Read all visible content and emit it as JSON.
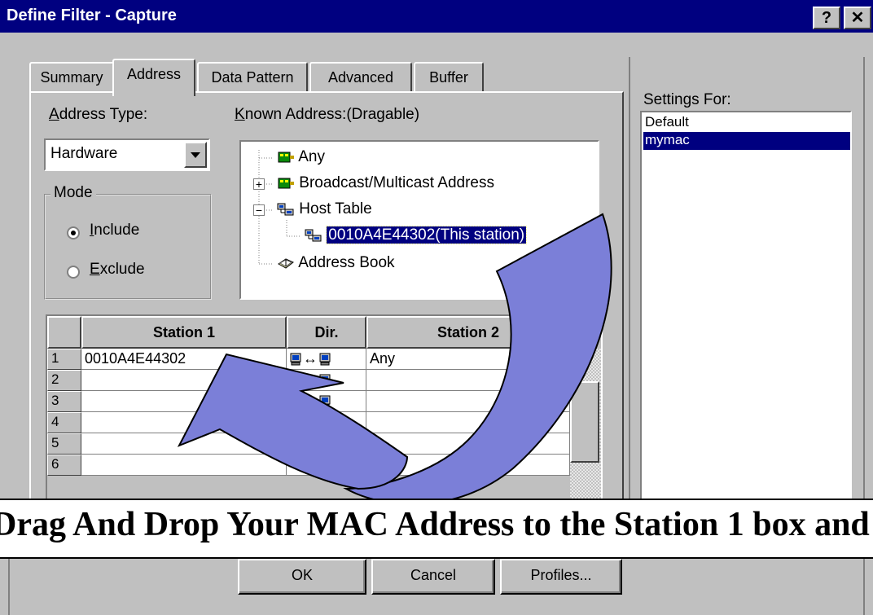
{
  "window": {
    "title": "Define Filter - Capture",
    "help_label": "?",
    "close_label": "✕"
  },
  "tabs": [
    {
      "label": "Summary"
    },
    {
      "label": "Address"
    },
    {
      "label": "Data Pattern"
    },
    {
      "label": "Advanced"
    },
    {
      "label": "Buffer"
    }
  ],
  "address_type": {
    "label_first": "A",
    "label_rest": "ddress Type:",
    "value": "Hardware"
  },
  "mode": {
    "legend": "Mode",
    "include_first": "I",
    "include_rest": "nclude",
    "exclude_first": "E",
    "exclude_rest": "xclude",
    "selected": "Include"
  },
  "known_address": {
    "label_first": "K",
    "label_rest": "nown Address:(Dragable)",
    "items": [
      {
        "label": "Any",
        "icon": "network-card-icon"
      },
      {
        "label": "Broadcast/Multicast Address",
        "icon": "network-card-icon",
        "expander": "+"
      },
      {
        "label": "Host Table",
        "icon": "host-table-icon",
        "expander": "−"
      },
      {
        "label": "0010A4E44302(This station)",
        "icon": "host-table-icon",
        "selected": true
      },
      {
        "label": "Address Book",
        "icon": "address-book-icon"
      }
    ]
  },
  "station_grid": {
    "headers": [
      "Station 1",
      "Dir.",
      "Station 2"
    ],
    "rows": [
      {
        "num": "1",
        "station1": "0010A4E44302",
        "dir": "↔",
        "station2": "Any"
      },
      {
        "num": "2",
        "station1": "",
        "dir": "↔",
        "station2": ""
      },
      {
        "num": "3",
        "station1": "",
        "dir": "↔",
        "station2": ""
      },
      {
        "num": "4",
        "station1": "",
        "dir": "",
        "station2": ""
      },
      {
        "num": "5",
        "station1": "",
        "dir": "",
        "station2": ""
      },
      {
        "num": "6",
        "station1": "",
        "dir": "",
        "station2": ""
      }
    ]
  },
  "settings_for": {
    "label": "Settings For:",
    "items": [
      {
        "label": "Default",
        "selected": false
      },
      {
        "label": "mymac",
        "selected": true
      }
    ]
  },
  "banner": {
    "text": "Drag And Drop Your MAC Address to the Station 1 box and"
  },
  "buttons": {
    "ok": "OK",
    "cancel": "Cancel",
    "profiles": "Profiles..."
  },
  "colors": {
    "title_bar": "#000080",
    "selection": "#000080",
    "arrow_fill": "#7b7fd8",
    "face": "#c0c0c0"
  }
}
